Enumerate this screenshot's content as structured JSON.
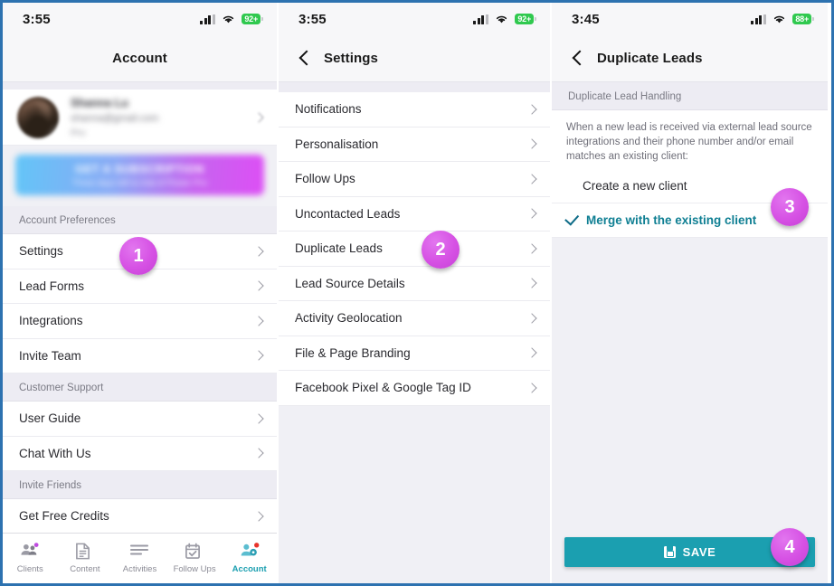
{
  "theme": {
    "accent_teal": "#1b9fb0",
    "badge_magenta": "#d651e4",
    "frame_blue": "#2d72b0",
    "battery_green": "#30c94f",
    "panel_bg": "#f0f0f5"
  },
  "panel1": {
    "status": {
      "time": "3:55",
      "battery": "92+",
      "signal_icon": "signal-bars-icon",
      "wifi_icon": "wifi-icon",
      "battery_icon": "battery-icon"
    },
    "header": {
      "title": "Account"
    },
    "profile": {
      "name": "Shanna Lu",
      "email": "shanna@gmail.com",
      "plan": "Pro",
      "avatar_icon": "avatar-photo",
      "chevron_icon": "chevron-right-icon"
    },
    "promo": {
      "title": "GET A SUBSCRIPTION",
      "subtitle": "Three days left to trial of Power Pro",
      "chevron_icon": "chevron-right-icon"
    },
    "sections": [
      {
        "title": "Account Preferences",
        "items": [
          {
            "label": "Settings",
            "icon": "chevron-right-icon"
          },
          {
            "label": "Lead Forms",
            "icon": "chevron-right-icon"
          },
          {
            "label": "Integrations",
            "icon": "chevron-right-icon"
          },
          {
            "label": "Invite Team",
            "icon": "chevron-right-icon"
          }
        ]
      },
      {
        "title": "Customer Support",
        "items": [
          {
            "label": "User Guide",
            "icon": "chevron-right-icon"
          },
          {
            "label": "Chat With Us",
            "icon": "chevron-right-icon"
          }
        ]
      },
      {
        "title": "Invite Friends",
        "items": [
          {
            "label": "Get Free Credits",
            "icon": "chevron-right-icon"
          }
        ]
      }
    ],
    "tabbar": [
      {
        "label": "Clients",
        "icon": "people-group-icon",
        "active": false,
        "dot": "purple"
      },
      {
        "label": "Content",
        "icon": "document-icon",
        "active": false,
        "dot": "none"
      },
      {
        "label": "Activities",
        "icon": "list-lines-icon",
        "active": false,
        "dot": "none"
      },
      {
        "label": "Follow Ups",
        "icon": "calendar-check-icon",
        "active": false,
        "dot": "none"
      },
      {
        "label": "Account",
        "icon": "person-gear-icon",
        "active": true,
        "dot": "red"
      }
    ]
  },
  "panel2": {
    "status": {
      "time": "3:55",
      "battery": "92+"
    },
    "header": {
      "title": "Settings",
      "back_icon": "back-chevron-icon"
    },
    "items": [
      {
        "label": "Notifications",
        "icon": "chevron-right-icon"
      },
      {
        "label": "Personalisation",
        "icon": "chevron-right-icon"
      },
      {
        "label": "Follow Ups",
        "icon": "chevron-right-icon"
      },
      {
        "label": "Uncontacted Leads",
        "icon": "chevron-right-icon"
      },
      {
        "label": "Duplicate Leads",
        "icon": "chevron-right-icon"
      },
      {
        "label": "Lead Source Details",
        "icon": "chevron-right-icon"
      },
      {
        "label": "Activity Geolocation",
        "icon": "chevron-right-icon"
      },
      {
        "label": "File & Page Branding",
        "icon": "chevron-right-icon"
      },
      {
        "label": "Facebook Pixel & Google Tag ID",
        "icon": "chevron-right-icon"
      }
    ]
  },
  "panel3": {
    "status": {
      "time": "3:45",
      "battery": "88+"
    },
    "header": {
      "title": "Duplicate Leads",
      "back_icon": "back-chevron-icon"
    },
    "section_title": "Duplicate Lead Handling",
    "description": "When a new lead is received via external lead source integrations and their phone number and/or email matches an existing client:",
    "options": [
      {
        "label": "Create a new client",
        "selected": false
      },
      {
        "label": "Merge with the existing client",
        "selected": true,
        "check_icon": "check-icon"
      }
    ],
    "save_button": {
      "label": "SAVE",
      "icon": "save-disk-icon"
    }
  },
  "badges": [
    {
      "number": "1"
    },
    {
      "number": "2"
    },
    {
      "number": "3"
    },
    {
      "number": "4"
    }
  ]
}
